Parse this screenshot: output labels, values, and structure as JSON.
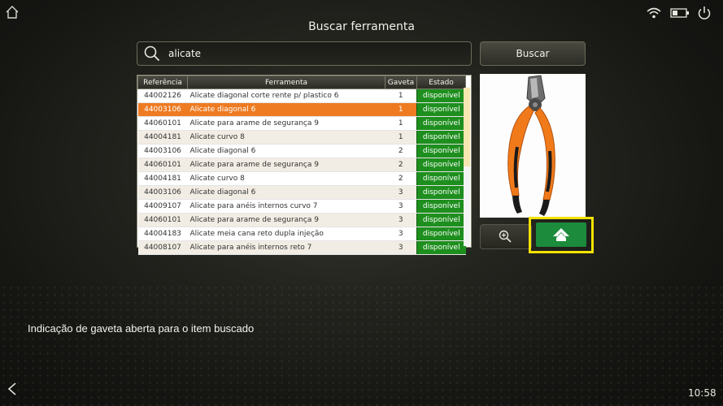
{
  "header": {
    "title": "Buscar ferramenta"
  },
  "search": {
    "value": "alicate",
    "button_label": "Buscar"
  },
  "table": {
    "columns": [
      "Referência",
      "Ferramenta",
      "Gaveta",
      "Estado"
    ],
    "rows": [
      {
        "ref": "44002126",
        "tool": "Alicate diagonal corte rente p/ plastico 6",
        "drawer": "1",
        "state": "disponível"
      },
      {
        "ref": "44003106",
        "tool": "Alicate diagonal 6",
        "drawer": "1",
        "state": "disponível"
      },
      {
        "ref": "44060101",
        "tool": "Alicate para arame de segurança 9",
        "drawer": "1",
        "state": "disponível"
      },
      {
        "ref": "44004181",
        "tool": "Alicate curvo 8",
        "drawer": "1",
        "state": "disponível"
      },
      {
        "ref": "44003106",
        "tool": "Alicate diagonal 6",
        "drawer": "2",
        "state": "disponível"
      },
      {
        "ref": "44060101",
        "tool": "Alicate para arame de segurança 9",
        "drawer": "2",
        "state": "disponível"
      },
      {
        "ref": "44004181",
        "tool": "Alicate curvo 8",
        "drawer": "2",
        "state": "disponível"
      },
      {
        "ref": "44003106",
        "tool": "Alicate diagonal 6",
        "drawer": "3",
        "state": "disponível"
      },
      {
        "ref": "44009107",
        "tool": "Alicate para anéis internos curvo 7",
        "drawer": "3",
        "state": "disponível"
      },
      {
        "ref": "44060101",
        "tool": "Alicate para arame de segurança 9",
        "drawer": "3",
        "state": "disponível"
      },
      {
        "ref": "44004183",
        "tool": "Alicate meia cana reto dupla injeção",
        "drawer": "3",
        "state": "disponível"
      },
      {
        "ref": "44008107",
        "tool": "Alicate para anéis internos reto 7",
        "drawer": "3",
        "state": "disponível"
      }
    ],
    "selected_index": 1
  },
  "caption": "Indicação de gaveta aberta para o item buscado",
  "status": {
    "time": "10:58"
  },
  "icons": {
    "home": "home-icon",
    "wifi": "wifi-icon",
    "battery": "battery-icon",
    "power": "power-icon",
    "back": "back-icon",
    "search": "search-icon",
    "zoom": "zoom-in-icon",
    "open_drawer": "arrow-up-icon"
  },
  "colors": {
    "selected_row": "#ee7b22",
    "status_available": "#1e8f1e",
    "highlight": "#f2e200",
    "drawer_button": "#1c8b3c"
  }
}
